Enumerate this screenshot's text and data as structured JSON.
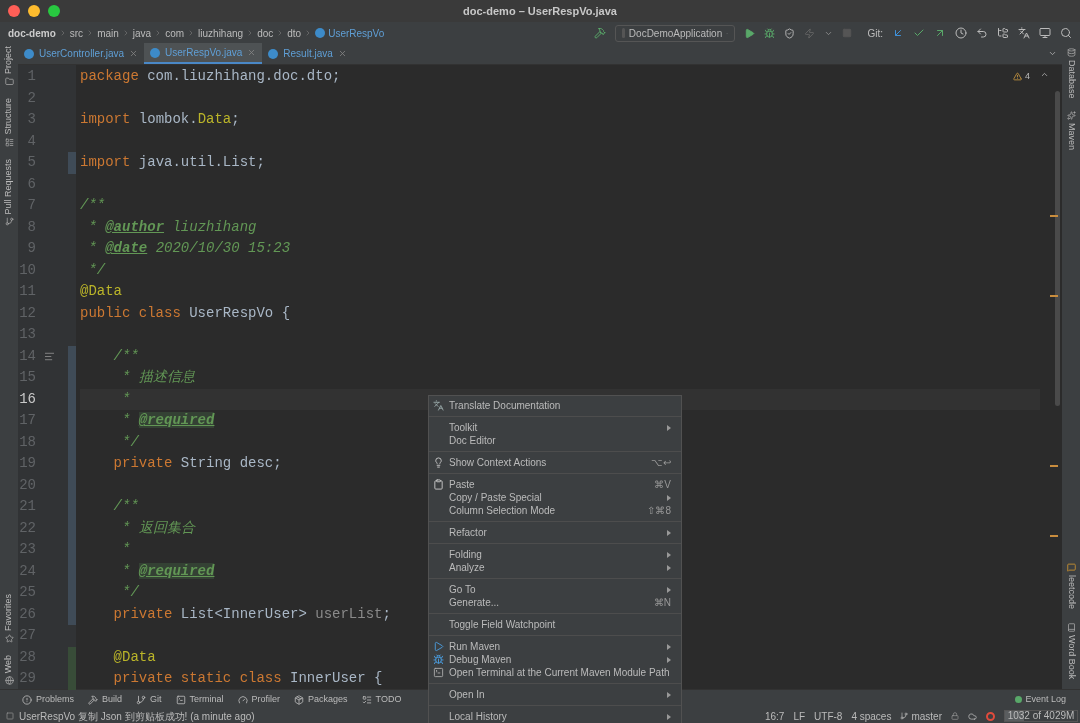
{
  "window": {
    "title": "doc-demo – UserRespVo.java"
  },
  "breadcrumbs": [
    {
      "label": "doc-demo",
      "kind": "project"
    },
    {
      "label": "src",
      "kind": "folder"
    },
    {
      "label": "main",
      "kind": "folder"
    },
    {
      "label": "java",
      "kind": "folder"
    },
    {
      "label": "com",
      "kind": "folder"
    },
    {
      "label": "liuzhihang",
      "kind": "folder"
    },
    {
      "label": "doc",
      "kind": "folder"
    },
    {
      "label": "dto",
      "kind": "folder"
    },
    {
      "label": "UserRespVo",
      "kind": "class"
    }
  ],
  "run_configuration": "DocDemoApplication",
  "git_label": "Git:",
  "tabs": [
    {
      "label": "UserController.java",
      "selected": false
    },
    {
      "label": "UserRespVo.java",
      "selected": true
    },
    {
      "label": "Result.java",
      "selected": false
    }
  ],
  "left_tool_windows": {
    "top": [
      "Project",
      "Structure",
      "Pull Requests"
    ],
    "bottom": [
      "Favorites",
      "Web"
    ]
  },
  "right_tool_windows": {
    "top": [
      "Database",
      "Maven"
    ],
    "bottom": [
      "leetcode",
      "Word Book"
    ]
  },
  "inspection_count": "4",
  "lines": [
    {
      "number": "1",
      "current": false,
      "modified": false,
      "added": false,
      "segments": [
        {
          "kind": "keyword",
          "text": "package"
        },
        {
          "kind": "plain",
          "text": " com.liuzhihang.doc.dto;"
        }
      ]
    },
    {
      "number": "2",
      "current": false,
      "modified": false,
      "added": false
    },
    {
      "number": "3",
      "current": false,
      "modified": false,
      "added": false,
      "segments": [
        {
          "kind": "keyword",
          "text": "import"
        },
        {
          "kind": "plain",
          "text": " lombok."
        },
        {
          "kind": "annotation",
          "text": "Data"
        },
        {
          "kind": "plain",
          "text": ";"
        }
      ]
    },
    {
      "number": "4",
      "current": false,
      "modified": false,
      "added": false
    },
    {
      "number": "5",
      "current": false,
      "modified": true,
      "added": false,
      "segments": [
        {
          "kind": "keyword",
          "text": "import"
        },
        {
          "kind": "plain",
          "text": " java.util.List;"
        }
      ]
    },
    {
      "number": "6",
      "current": false,
      "modified": false,
      "added": false
    },
    {
      "number": "7",
      "current": false,
      "modified": false,
      "added": false,
      "segments": [
        {
          "kind": "comment",
          "text": "/**"
        }
      ]
    },
    {
      "number": "8",
      "current": false,
      "modified": false,
      "added": false,
      "segments": [
        {
          "kind": "comment",
          "text": " * "
        },
        {
          "kind": "doctag",
          "text": "@author"
        },
        {
          "kind": "comment",
          "text": " liuzhihang"
        }
      ]
    },
    {
      "number": "9",
      "current": false,
      "modified": false,
      "added": false,
      "segments": [
        {
          "kind": "comment",
          "text": " * "
        },
        {
          "kind": "doctag",
          "text": "@date"
        },
        {
          "kind": "comment",
          "text": " 2020/10/30 15:23"
        }
      ]
    },
    {
      "number": "10",
      "current": false,
      "modified": false,
      "added": false,
      "segments": [
        {
          "kind": "comment",
          "text": " */"
        }
      ]
    },
    {
      "number": "11",
      "current": false,
      "modified": false,
      "added": false,
      "segments": [
        {
          "kind": "annotation",
          "text": "@Data"
        }
      ]
    },
    {
      "number": "12",
      "current": false,
      "modified": false,
      "added": false,
      "segments": [
        {
          "kind": "keyword",
          "text": "public class "
        },
        {
          "kind": "plain",
          "text": "UserRespVo {"
        }
      ]
    },
    {
      "number": "13",
      "current": false,
      "modified": false,
      "added": false
    },
    {
      "number": "14",
      "current": false,
      "modified": true,
      "added": false,
      "segments": [
        {
          "kind": "comment",
          "text": "    /**"
        }
      ]
    },
    {
      "number": "15",
      "current": false,
      "modified": true,
      "added": false,
      "segments": [
        {
          "kind": "comment",
          "text": "     * 描述信息"
        }
      ]
    },
    {
      "number": "16",
      "current": true,
      "modified": true,
      "added": false,
      "segments": [
        {
          "kind": "comment",
          "text": "     *"
        }
      ]
    },
    {
      "number": "17",
      "current": false,
      "modified": true,
      "added": false,
      "segments": [
        {
          "kind": "comment",
          "text": "     * "
        },
        {
          "kind": "doctag-highlight",
          "text": "@required"
        }
      ]
    },
    {
      "number": "18",
      "current": false,
      "modified": true,
      "added": false,
      "segments": [
        {
          "kind": "comment",
          "text": "     */"
        }
      ]
    },
    {
      "number": "19",
      "current": false,
      "modified": true,
      "added": false,
      "segments": [
        {
          "kind": "keyword",
          "text": "    private "
        },
        {
          "kind": "plain",
          "text": "String desc;"
        }
      ]
    },
    {
      "number": "20",
      "current": false,
      "modified": true,
      "added": false
    },
    {
      "number": "21",
      "current": false,
      "modified": true,
      "added": false,
      "segments": [
        {
          "kind": "comment",
          "text": "    /**"
        }
      ]
    },
    {
      "number": "22",
      "current": false,
      "modified": true,
      "added": false,
      "segments": [
        {
          "kind": "comment",
          "text": "     * 返回集合"
        }
      ]
    },
    {
      "number": "23",
      "current": false,
      "modified": true,
      "added": false,
      "segments": [
        {
          "kind": "comment",
          "text": "     *"
        }
      ]
    },
    {
      "number": "24",
      "current": false,
      "modified": true,
      "added": false,
      "segments": [
        {
          "kind": "comment",
          "text": "     * "
        },
        {
          "kind": "doctag-highlight",
          "text": "@required"
        }
      ]
    },
    {
      "number": "25",
      "current": false,
      "modified": true,
      "added": false,
      "segments": [
        {
          "kind": "comment",
          "text": "     */"
        }
      ]
    },
    {
      "number": "26",
      "current": false,
      "modified": true,
      "added": false,
      "segments": [
        {
          "kind": "keyword",
          "text": "    private "
        },
        {
          "kind": "plain",
          "text": "List<InnerUser> "
        },
        {
          "kind": "unused",
          "text": "userList"
        },
        {
          "kind": "plain",
          "text": ";"
        }
      ]
    },
    {
      "number": "27",
      "current": false,
      "modified": false,
      "added": false
    },
    {
      "number": "28",
      "current": false,
      "modified": false,
      "added": true,
      "segments": [
        {
          "kind": "annotation",
          "text": "    @Data"
        }
      ]
    },
    {
      "number": "29",
      "current": false,
      "modified": false,
      "added": true,
      "segments": [
        {
          "kind": "keyword",
          "text": "    private static class "
        },
        {
          "kind": "plain",
          "text": "InnerUser {"
        }
      ]
    }
  ],
  "context_menu": [
    [
      {
        "label": "Translate Documentation",
        "kind": "translate",
        "submenu": false
      }
    ],
    [
      {
        "label": "Toolkit",
        "kind": "plain",
        "submenu": true
      },
      {
        "label": "Doc Editor",
        "kind": "plain",
        "submenu": false
      }
    ],
    [
      {
        "label": "Show Context Actions",
        "kind": "bulb",
        "shortcut": "⌥↩",
        "submenu": false
      }
    ],
    [
      {
        "label": "Paste",
        "kind": "clipboard",
        "shortcut": "⌘V",
        "submenu": false
      },
      {
        "label": "Copy / Paste Special",
        "kind": "plain",
        "submenu": true
      },
      {
        "label": "Column Selection Mode",
        "kind": "plain",
        "shortcut": "⇧⌘8",
        "submenu": false
      }
    ],
    [
      {
        "label": "Refactor",
        "kind": "plain",
        "submenu": true
      }
    ],
    [
      {
        "label": "Folding",
        "kind": "plain",
        "submenu": true
      },
      {
        "label": "Analyze",
        "kind": "plain",
        "submenu": true
      }
    ],
    [
      {
        "label": "Go To",
        "kind": "plain",
        "submenu": true
      },
      {
        "label": "Generate...",
        "kind": "plain",
        "shortcut": "⌘N",
        "submenu": false
      }
    ],
    [
      {
        "label": "Toggle Field Watchpoint",
        "kind": "plain",
        "submenu": false
      }
    ],
    [
      {
        "label": "Run Maven",
        "kind": "maven-run",
        "submenu": true
      },
      {
        "label": "Debug Maven",
        "kind": "maven-debug",
        "submenu": true
      },
      {
        "label": "Open Terminal at the Current Maven Module Path",
        "kind": "terminal",
        "submenu": false
      }
    ],
    [
      {
        "label": "Open In",
        "kind": "plain",
        "submenu": true
      }
    ],
    [
      {
        "label": "Local History",
        "kind": "plain",
        "submenu": true
      }
    ]
  ],
  "tool_buttons": [
    {
      "label": "Problems",
      "kind": "problems"
    },
    {
      "label": "Build",
      "kind": "build"
    },
    {
      "label": "Git",
      "kind": "git"
    },
    {
      "label": "Terminal",
      "kind": "terminal"
    },
    {
      "label": "Profiler",
      "kind": "profiler"
    },
    {
      "label": "Packages",
      "kind": "packages"
    },
    {
      "label": "TODO",
      "kind": "todo"
    }
  ],
  "event_log": "Event Log",
  "status_bar": {
    "message": "UserRespVo 复制 Json 到剪贴板成功! (a minute ago)",
    "position": "16:7",
    "line_separator": "LF",
    "encoding": "UTF-8",
    "indent": "4 spaces",
    "branch": "master",
    "memory": {
      "text": "1032 of 4029M",
      "level": 0.26
    }
  }
}
